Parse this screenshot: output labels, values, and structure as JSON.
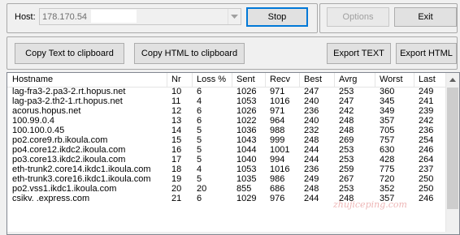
{
  "host": {
    "label": "Host:",
    "value": "178.170.54",
    "stop_label": "Stop"
  },
  "top_right": {
    "options_label": "Options",
    "exit_label": "Exit"
  },
  "toolbar": {
    "copy_text_label": "Copy Text to clipboard",
    "copy_html_label": "Copy HTML to clipboard",
    "export_text_label": "Export TEXT",
    "export_html_label": "Export HTML"
  },
  "table": {
    "columns": [
      "Hostname",
      "Nr",
      "Loss %",
      "Sent",
      "Recv",
      "Best",
      "Avrg",
      "Worst",
      "Last"
    ],
    "rows": [
      [
        "lag-fra3-2.pa3-2.rt.hopus.net",
        "10",
        "6",
        "1026",
        "971",
        "247",
        "253",
        "360",
        "249"
      ],
      [
        "lag-pa3-2.th2-1.rt.hopus.net",
        "11",
        "4",
        "1053",
        "1016",
        "240",
        "247",
        "345",
        "241"
      ],
      [
        "acorus.hopus.net",
        "12",
        "6",
        "1026",
        "971",
        "236",
        "242",
        "349",
        "239"
      ],
      [
        "100.99.0.4",
        "13",
        "6",
        "1022",
        "964",
        "240",
        "248",
        "357",
        "242"
      ],
      [
        "100.100.0.45",
        "14",
        "5",
        "1036",
        "988",
        "232",
        "248",
        "705",
        "236"
      ],
      [
        "po2.core9.rb.ikoula.com",
        "15",
        "5",
        "1043",
        "999",
        "248",
        "269",
        "757",
        "254"
      ],
      [
        "po4.core12.ikdc2.ikoula.com",
        "16",
        "5",
        "1044",
        "1001",
        "244",
        "253",
        "630",
        "246"
      ],
      [
        "po3.core13.ikdc2.ikoula.com",
        "17",
        "5",
        "1040",
        "994",
        "244",
        "253",
        "428",
        "264"
      ],
      [
        "eth-trunk2.core14.ikdc1.ikoula.com",
        "18",
        "4",
        "1053",
        "1016",
        "236",
        "259",
        "775",
        "237"
      ],
      [
        "eth-trunk3.core16.ikdc1.ikoula.com",
        "19",
        "5",
        "1035",
        "986",
        "249",
        "267",
        "720",
        "250"
      ],
      [
        "po2.vss1.ikdc1.ikoula.com",
        "20",
        "20",
        "855",
        "686",
        "248",
        "253",
        "352",
        "250"
      ],
      [
        "csikv.          .express.com",
        "21",
        "6",
        "1029",
        "976",
        "244",
        "248",
        "357",
        "246"
      ]
    ]
  },
  "watermark": "zhujiceping.com",
  "icons": {
    "combo_arrow": "chevron-down-icon",
    "scroll_up": "arrow-up-icon"
  }
}
